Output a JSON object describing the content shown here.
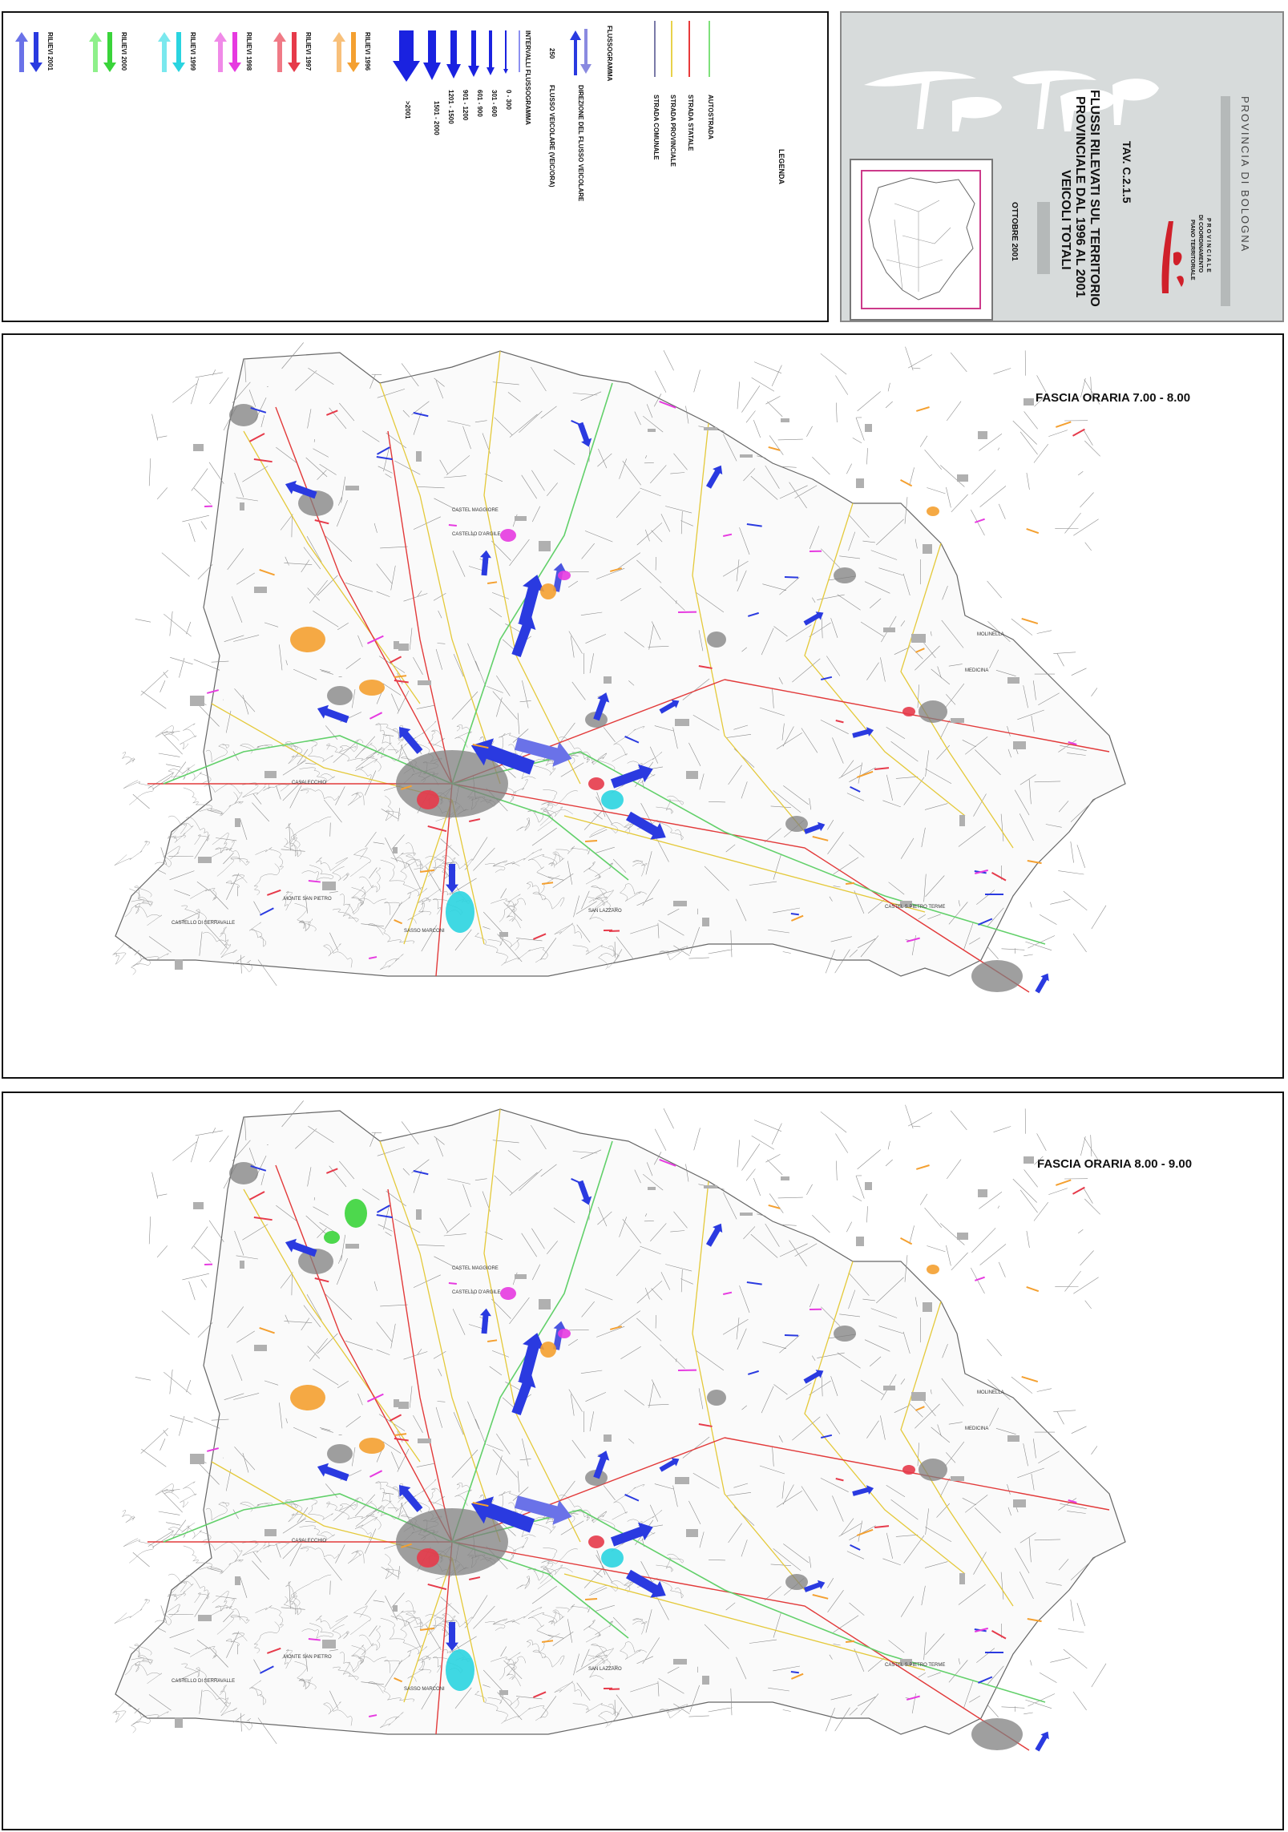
{
  "legend": {
    "title": "LEGENDA",
    "road_types": [
      {
        "label": "AUTOSTRADA",
        "color": "#7ee07a"
      },
      {
        "label": "STRADA STATALE",
        "color": "#e83a3a"
      },
      {
        "label": "STRADA PROVINCIALE",
        "color": "#e8d24a"
      },
      {
        "label": "STRADA COMUNALE",
        "color": "#7a7aa8"
      }
    ],
    "flussogramma_label": "FLUSSOGRAMMA",
    "direzione_label": "DIREZIONE DEL FLUSSO VEICOLARE",
    "flusso_value": "250",
    "flusso_label": "FLUSSO VEICOLARE (VEIC/ORA)",
    "intervalli_title": "INTERVALLI FLUSSOGRAMMA",
    "intervalli": [
      "0 - 300",
      "301 - 600",
      "601 - 900",
      "901 - 1200",
      "1201 - 1500",
      "1501 - 2000",
      ">2001"
    ],
    "rilievi": [
      {
        "label": "RILIEVI 2001",
        "color": "#2a3ae0",
        "color2": "#6a72e8"
      },
      {
        "label": "RILIEVI 2000",
        "color": "#3ad43a",
        "color2": "#8ef08a"
      },
      {
        "label": "RILIEVI 1999",
        "color": "#2ad4e0",
        "color2": "#7ae8ee"
      },
      {
        "label": "RILIEVI 1998",
        "color": "#e63ae0",
        "color2": "#f08ae8"
      },
      {
        "label": "RILIEVI 1997",
        "color": "#e63a4a",
        "color2": "#f07a86"
      },
      {
        "label": "RILIEVI 1996",
        "color": "#f4a030",
        "color2": "#f8c07a"
      }
    ]
  },
  "title_block": {
    "provincia": "PROVINCIA DI BOLOGNA",
    "ptcp_line1": "PIANO TERRITORIALE",
    "ptcp_line2": "DI COORDINAMENTO",
    "ptcp_line3": "PROVINCIALE",
    "tav": "TAV. C.2.1.5",
    "title_line1": "FLUSSI RILEVATI SUL TERRITORIO",
    "title_line2": "PROVINCIALE DAL 1996 AL 2001",
    "title_line3": "VEICOLI TOTALI",
    "date": "OTTOBRE 2001",
    "logo_text": "PTCP",
    "logo_small": "PTCP"
  },
  "maps": [
    {
      "fascia": "FASCIA ORARIA 7.00 - 8.00"
    },
    {
      "fascia": "FASCIA ORARIA 8.00 - 9.00"
    }
  ],
  "town_labels": [
    "CASTEL MAGGIORE",
    "CASTELLO D'ARGILE",
    "MOLINELLA",
    "MEDICINA",
    "MONTE SAN PIETRO",
    "CASTELLO DI SERRAVALLE",
    "SASSO MARCONI",
    "CASTEL S.PIETRO TERME",
    "SAN LAZZARO",
    "CASALECCHIO"
  ],
  "colors": {
    "title_bg": "#d7dbdb",
    "ptcp_red": "#d0202a",
    "map_road": "#9a9a9a",
    "urban_grey": "#8a8a8a"
  }
}
